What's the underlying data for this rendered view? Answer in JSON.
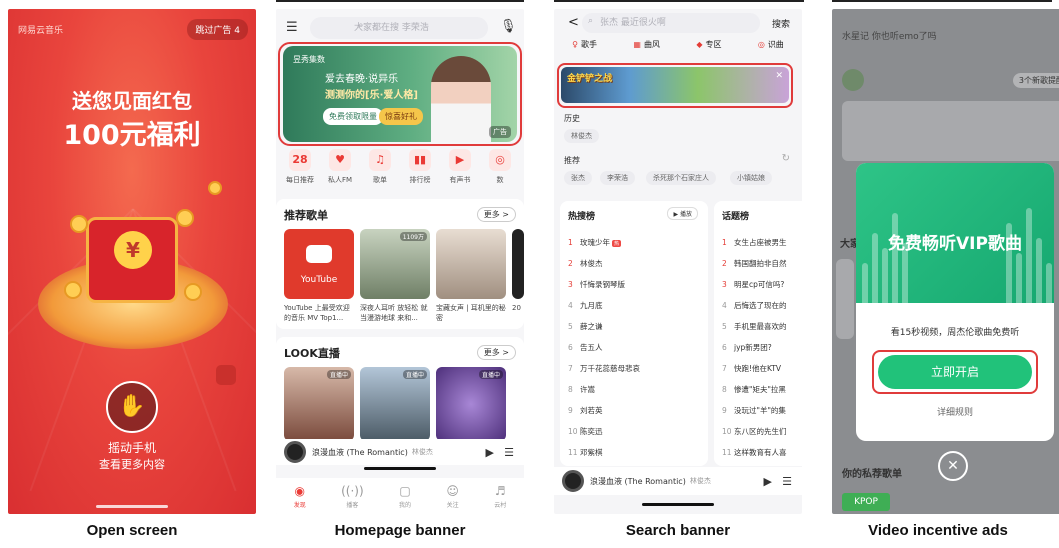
{
  "captions": {
    "open_screen": "Open screen",
    "homepage_banner": "Homepage banner",
    "search_banner": "Search banner",
    "video_incentive": "Video incentive ads"
  },
  "open_screen": {
    "app_logo": "网易云音乐",
    "skip_button": "跳过广告 4",
    "headline1": "送您见面红包",
    "headline2": "100元福利",
    "coin_symbol": "¥",
    "shake_icon": "hand-phone-icon",
    "shake_title": "摇动手机",
    "shake_sub": "查看更多内容",
    "bg_color": "#e9453d"
  },
  "homepage": {
    "search_placeholder": "大家都在搜 李荣浩",
    "banner": {
      "brand": "昱秀集数",
      "line1": "爱去春晚·说异乐",
      "line2": "测测你的[乐·爱人格]",
      "btn1": "免费领取限量",
      "btn2": "惊喜好礼",
      "ad_tag": "广告"
    },
    "nav": [
      {
        "icon": "28",
        "label": "每日推荐"
      },
      {
        "icon": "♥",
        "label": "私人FM"
      },
      {
        "icon": "♫",
        "label": "歌单"
      },
      {
        "icon": "▮▮",
        "label": "排行榜"
      },
      {
        "icon": "▶",
        "label": "有声书"
      },
      {
        "icon": "◎",
        "label": "数"
      }
    ],
    "playlists_title": "推荐歌单",
    "more": "更多 >",
    "playlists": [
      {
        "badge": "",
        "title": "YouTube 上最受欢迎的音乐 MV Top1...",
        "logo": "YouTube"
      },
      {
        "badge": "1109万",
        "title": "深夜人耳听 放轻松 就当漫游地球 来和...",
        "logo": ""
      },
      {
        "badge": "",
        "title": "宝藏女声 | 耳机里的秘密",
        "logo": ""
      },
      {
        "badge": "",
        "title": "20",
        "logo": ""
      }
    ],
    "live_title": "LOOK直播",
    "live_more": "更多 >",
    "live_badges": [
      "直播中",
      "直播中",
      "直播中"
    ],
    "player_song": "浪漫血液 (The Romantic)",
    "player_artist": "林俊杰",
    "tabs": [
      {
        "icon": "◉",
        "label": "发现"
      },
      {
        "icon": "((·))",
        "label": "播客"
      },
      {
        "icon": "▢",
        "label": "我的"
      },
      {
        "icon": "☺",
        "label": "关注"
      },
      {
        "icon": "♬",
        "label": "云村"
      }
    ]
  },
  "search": {
    "back": "<",
    "placeholder": "张杰 最近很火啊",
    "search_button": "搜索",
    "categories": [
      {
        "icon": "♀",
        "label": "歌手"
      },
      {
        "icon": "▦",
        "label": "曲风"
      },
      {
        "icon": "◆",
        "label": "专区"
      },
      {
        "icon": "◎",
        "label": "识曲"
      }
    ],
    "banner_logo": "金铲铲之战",
    "banner_close": "✕",
    "history_label": "历史",
    "history_chip": "林俊杰",
    "recommend_label": "推荐",
    "recommend_chips": [
      "张杰",
      "李荣浩",
      "杀死那个石家庄人",
      "小镇姑娘"
    ],
    "hot_title": "热搜榜",
    "play_label": "▶ 播放",
    "topic_title": "话题榜",
    "hot": [
      "玫瑰少年",
      "林俊杰",
      "忏悔录钢琴版",
      "九月底",
      "薛之谦",
      "告五人",
      "万千花蕊慈母悲哀",
      "许嵩",
      "刘若英",
      "陈奕迅",
      "邓紫棋"
    ],
    "hot_tag": "热",
    "topics": [
      "女生占座被男生",
      "韩国翻拍非自然",
      "明星cp可信吗?",
      "后悔选了现在的",
      "手机里最喜欢的",
      "jyp新男团?",
      "快跑!他在KTV",
      "惨遭\"矩夫\"拉黑",
      "没玩过\"羊\"的集",
      "东八区的先生们",
      "这样教育有人喜"
    ],
    "player_song": "浪漫血液 (The Romantic)",
    "player_artist": "林俊杰"
  },
  "video_ad": {
    "bg_search": "水星记 你也听emo了吗",
    "bg_new": "3个新歌提醒",
    "bg_big": "大家",
    "bg_private": "你的私荐歌单",
    "bg_kpop": "KPOP",
    "dialog_title": "免费畅听VIP歌曲",
    "dialog_sub": "看15秒视频，周杰伦歌曲免费听",
    "open_button": "立即开启",
    "rules": "详细规则",
    "close_icon": "✕",
    "accent": "#21c27a"
  }
}
